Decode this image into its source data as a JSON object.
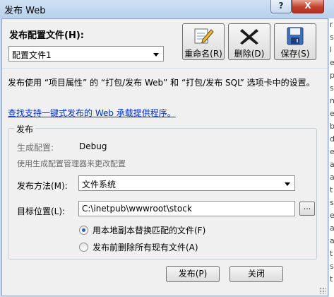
{
  "window": {
    "title": "发布 Web",
    "help_label": "?",
    "close_label": "X"
  },
  "header": {
    "profile_label": "发布配置文件(H):",
    "profile_selected": "配置文件1",
    "buttons": {
      "rename": "重命名(R)",
      "delete": "删除(D)",
      "save": "保存(S)"
    }
  },
  "description": "发布使用 “项目属性” 的 “打包/发布 Web” 和 “打包/发布 SQL” 选项卡中的设置。",
  "link": "查找支持一键式发布的 Web 承载提供程序。",
  "publish_group": {
    "title": "发布",
    "build_config_label": "生成配置:",
    "build_config_value": "Debug",
    "build_config_hint": "使用生成配置管理器来更改配置",
    "method_label": "发布方法(M):",
    "method_value": "文件系统",
    "target_label": "目标位置(L):",
    "target_value": "C:\\inetpub\\wwwroot\\stock",
    "browse_label": "...",
    "option_replace": "用本地副本替换匹配的文件(F)",
    "option_delete": "发布前删除所有现有文件(A)"
  },
  "footer": {
    "publish": "发布(P)",
    "close": "关闭"
  },
  "background_strip": [
    "r",
    "s",
    "l",
    "e",
    "p",
    "s",
    "n",
    "e",
    "b",
    "d",
    "e",
    "a",
    "a",
    "t",
    "s",
    "e",
    "a",
    "a",
    "t",
    "s",
    "t"
  ]
}
